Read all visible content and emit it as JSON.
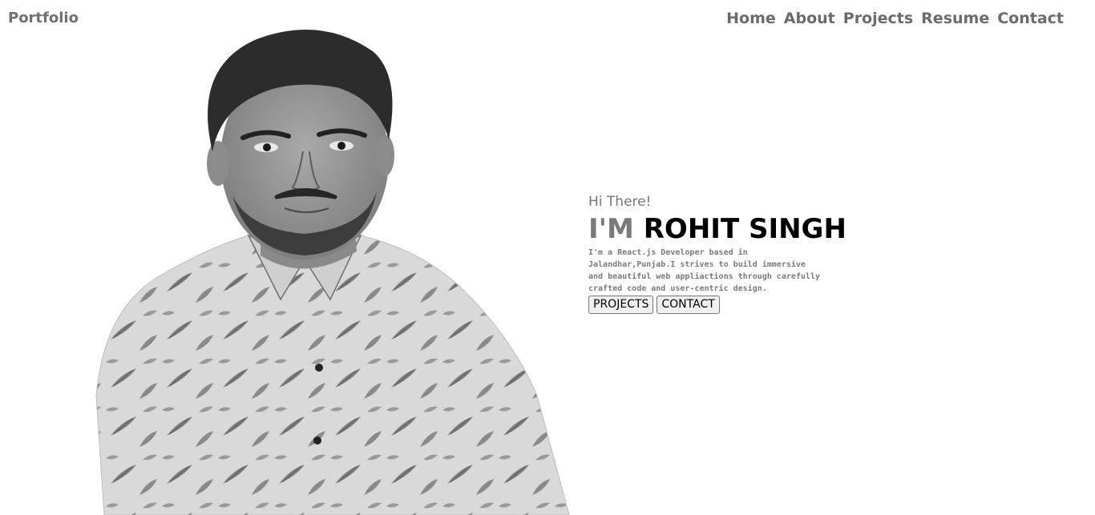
{
  "nav": {
    "brand": "Portfolio",
    "links": [
      "Home",
      "About",
      "Projects",
      "Resume",
      "Contact"
    ]
  },
  "hero": {
    "greeting": "Hi There!",
    "prefix": "I'M",
    "name": "ROHIT SINGH",
    "bio": "I'm a React.js Developer based in Jalandhar,Punjab.I strives to build immersive and beautiful web appliactions through carefully crafted code and user-centric design.",
    "buttons": {
      "projects": "PROJECTS",
      "contact": "CONTACT"
    }
  },
  "colors": {
    "accent_gray": "#7a7a7a",
    "nav_gray": "#6b6b6b",
    "name_black": "#000000"
  }
}
